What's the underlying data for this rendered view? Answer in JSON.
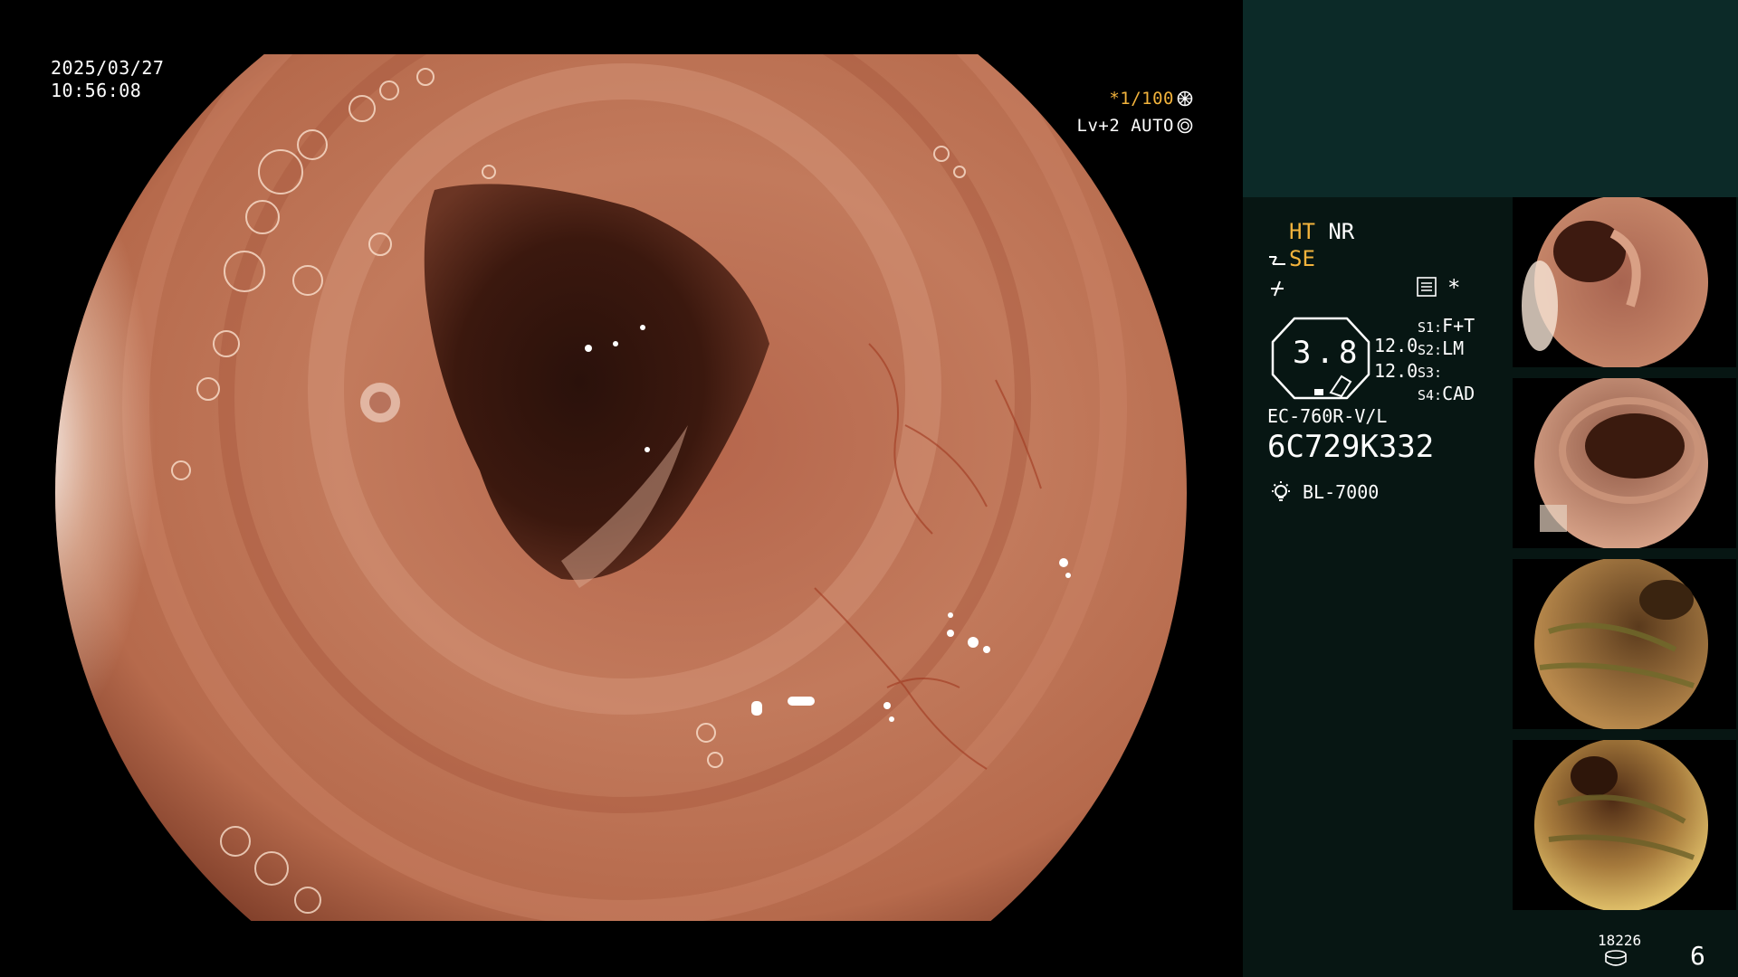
{
  "overlay": {
    "date": "2025/03/27",
    "time": "10:56:08",
    "shutter": "*1/100",
    "level": "Lv+2",
    "mode": "AUTO"
  },
  "panel": {
    "ht": "HT",
    "nr": "NR",
    "se": "SE",
    "star": "*",
    "gauge_value": "3.8",
    "value_1": "12.0",
    "value_2": "12.0",
    "s1_key": "S1:",
    "s1_val": "F+T",
    "s2_key": "S2:",
    "s2_val": "LM",
    "s3_key": "S3:",
    "s3_val": "",
    "s4_key": "S4:",
    "s4_val": "CAD",
    "scope_model": "EC-760R-V/L",
    "scope_serial": "6C729K332",
    "light_source": "BL-7000",
    "image_count": "18226",
    "frame_number": "6"
  },
  "icons": [
    "shutter-wheel-icon",
    "auto-iris-icon",
    "structure-enhance-icon",
    "freeze-icon",
    "menu-icon",
    "bulb-icon",
    "storage-icon"
  ],
  "colors": {
    "accent_orange": "#f2b33c",
    "panel_top": "#0c2a28",
    "panel_bg": "#071613"
  }
}
